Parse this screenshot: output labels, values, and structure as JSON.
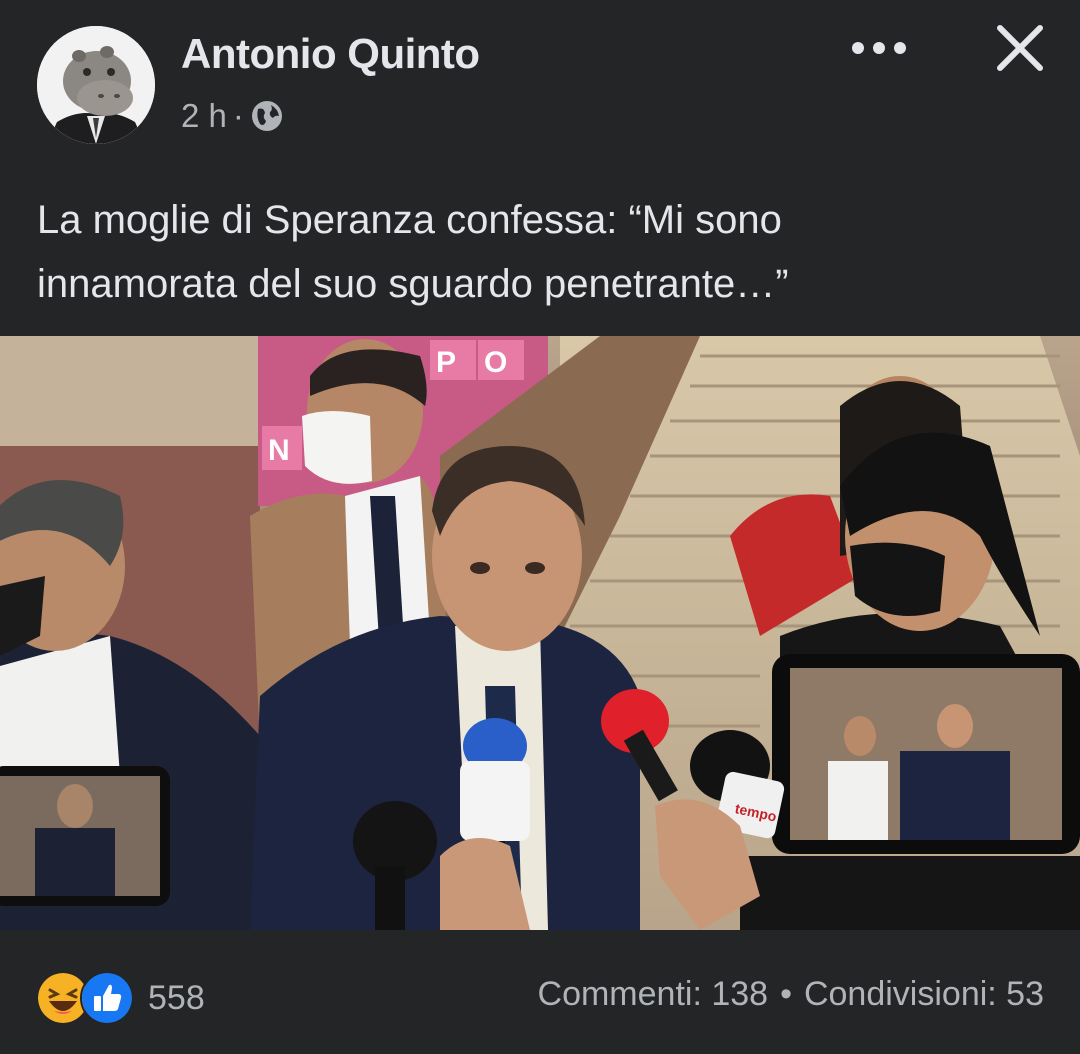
{
  "post": {
    "author": "Antonio Quinto",
    "time": "2 h",
    "separator": "·",
    "audience_icon": "globe-icon",
    "caption_line1": "La moglie di Speranza confessa: “Mi sono",
    "caption_line2": "innamorata del suo sguardo penetrante…”"
  },
  "photo": {
    "wall_letters": [
      "P",
      "O",
      "N"
    ],
    "mic_sticker": "tempo"
  },
  "footer": {
    "reaction_icons": [
      "haha-icon",
      "like-icon"
    ],
    "reaction_count": "558",
    "comments": "Commenti: 138",
    "dot": "•",
    "shares": "Condivisioni: 53"
  },
  "colors": {
    "background": "#242526",
    "text_primary": "#e4e6eb",
    "text_secondary": "#b0b3b8",
    "like_blue": "#1877f2",
    "haha_yellow": "#f7b125"
  }
}
